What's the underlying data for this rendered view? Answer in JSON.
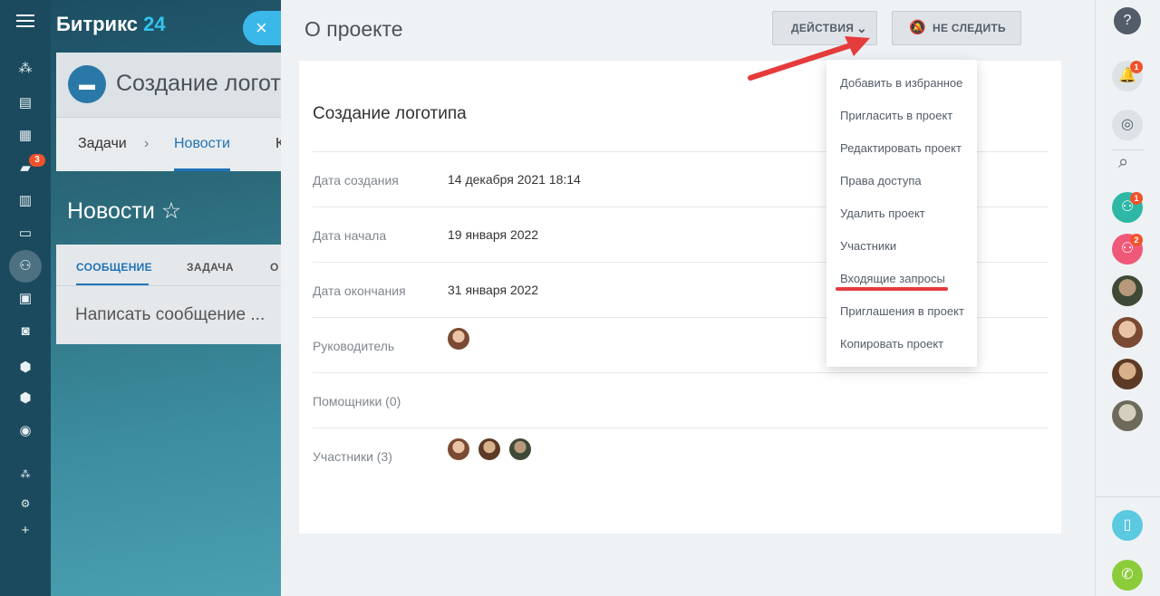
{
  "app": {
    "logo_name": "Битрикс",
    "logo_number": "24"
  },
  "nav": {
    "chat_badge": "3"
  },
  "background": {
    "project_title": "Создание логоти",
    "tabs": [
      "Задачи",
      "Новости",
      "К"
    ],
    "news_title": "Новости",
    "news_tabs": [
      "СООБЩЕНИЕ",
      "ЗАДАЧА",
      "О"
    ],
    "message_placeholder": "Написать сообщение ..."
  },
  "panel": {
    "title": "О проекте",
    "actions_label": "ДЕЙСТВИЯ",
    "unfollow_label": "НЕ СЛЕДИТЬ",
    "project_name": "Создание логотипа",
    "fields": [
      {
        "label": "Дата создания",
        "value": "14 декабря 2021 18:14"
      },
      {
        "label": "Дата начала",
        "value": "19 января 2022"
      },
      {
        "label": "Дата окончания",
        "value": "31 января 2022"
      },
      {
        "label": "Руководитель",
        "value": ""
      },
      {
        "label": "Помощники (0)",
        "value": ""
      },
      {
        "label": "Участники (3)",
        "value": ""
      }
    ]
  },
  "menu": {
    "items": [
      "Добавить в избранное",
      "Пригласить в проект",
      "Редактировать проект",
      "Права доступа",
      "Удалить проект",
      "Участники",
      "Входящие запросы",
      "Приглашения в проект",
      "Копировать проект"
    ],
    "highlighted_item": "Входящие запросы"
  },
  "rightbar": {
    "notifications_badge": "1",
    "group1_badge": "1",
    "group2_badge": "2"
  },
  "colors": {
    "accent": "#1f73b7",
    "annotation_red": "#e53b3b",
    "badge": "#f0532c"
  }
}
